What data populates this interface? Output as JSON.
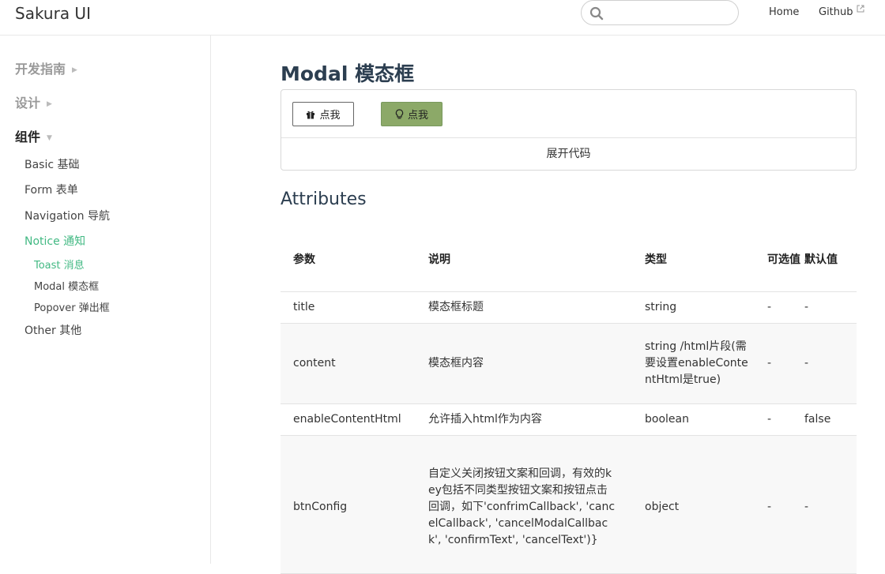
{
  "header": {
    "logo": "Sakura UI",
    "search": {
      "placeholder": "",
      "value": ""
    },
    "nav": {
      "home": "Home",
      "github": "Github"
    }
  },
  "sidebar": {
    "sections": [
      {
        "label": "开发指南"
      },
      {
        "label": "设计"
      },
      {
        "label": "组件"
      }
    ],
    "items": [
      {
        "label": "Basic 基础"
      },
      {
        "label": "Form 表单"
      },
      {
        "label": "Navigation 导航"
      },
      {
        "label": "Notice 通知"
      },
      {
        "label": "Other 其他"
      }
    ],
    "notice_children": [
      {
        "label": "Toast 消息"
      },
      {
        "label": "Modal 模态框"
      },
      {
        "label": "Popover 弹出框"
      }
    ]
  },
  "main": {
    "title": "Modal 模态框",
    "demo": {
      "button1": "点我",
      "button2": "点我",
      "expand": "展开代码"
    },
    "attributes_title": "Attributes",
    "table": {
      "headers": [
        "参数",
        "说明",
        "类型",
        "可选值",
        "默认值"
      ],
      "rows": [
        [
          "title",
          "模态框标题",
          "string",
          "-",
          "-"
        ],
        [
          "content",
          "模态框内容",
          "string /html片段(需要设置enableContentHtml是true)",
          "-",
          "-"
        ],
        [
          "enableContentHtml",
          "允许插入html作为内容",
          "boolean",
          "-",
          "false"
        ],
        [
          "btnConfig",
          "自定义关闭按钮文案和回调，有效的key包括不同类型按钮文案和按钮点击回调，如下'confrimCallback', 'cancelCallback', 'cancelModalCallback', 'confirmText', 'cancelText')}",
          "object",
          "-",
          "-"
        ]
      ]
    }
  },
  "colors": {
    "accent": "#42b983",
    "button_green": "#8ca968",
    "title": "#2c3e50"
  }
}
